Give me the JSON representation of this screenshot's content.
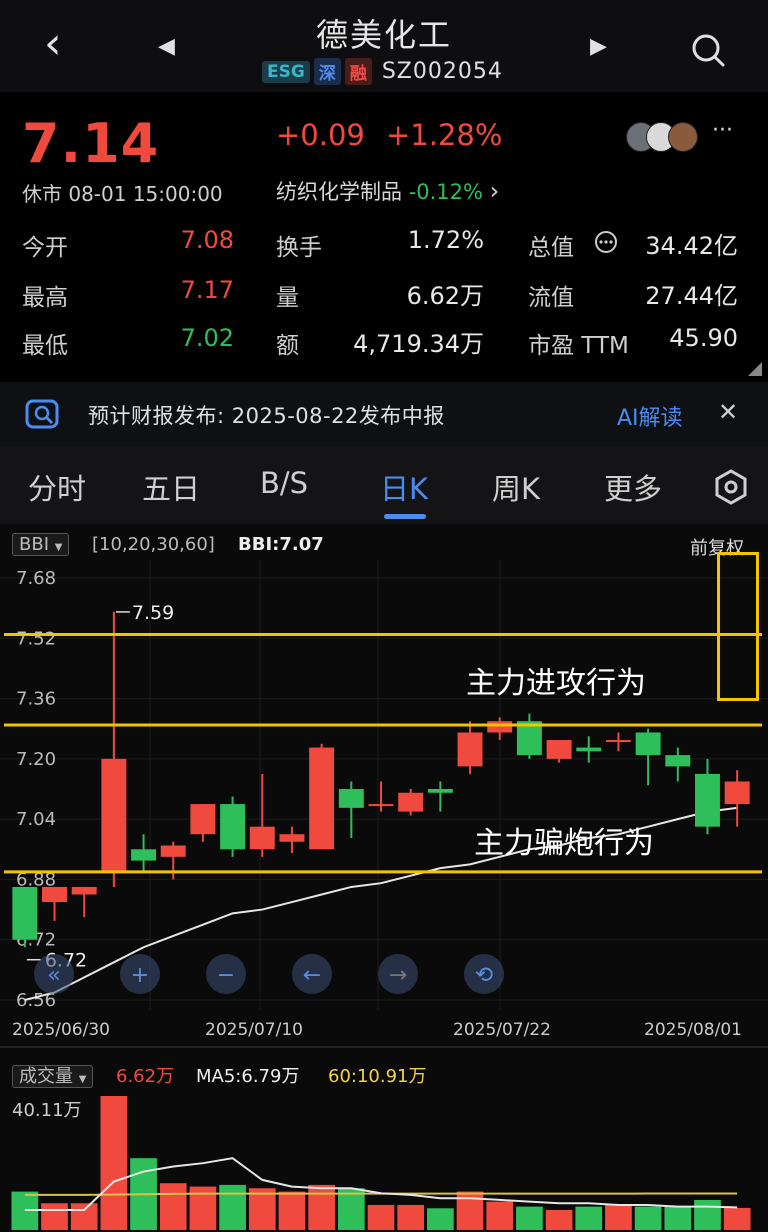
{
  "nav": {
    "back_icon": "‹",
    "prev_icon": "◀",
    "next_icon": "▶",
    "title": "德美化工",
    "badges": [
      "ESG",
      "深",
      "融"
    ],
    "code": "SZ002054"
  },
  "quote": {
    "price": "7.14",
    "change": "+0.09",
    "change_pct": "+1.28%",
    "status": "休市 08-01 15:00:00",
    "sector_name": "纺织化学制品",
    "sector_pct": "-0.12%",
    "sector_arrow": "›",
    "more": "···",
    "stats": [
      {
        "label": "今开",
        "value": "7.08",
        "color": "red"
      },
      {
        "label": "换手",
        "value": "1.72%",
        "color": "white"
      },
      {
        "label": "总值",
        "value": "34.42亿",
        "color": "white"
      },
      {
        "label": "最高",
        "value": "7.17",
        "color": "red"
      },
      {
        "label": "量",
        "value": "6.62万",
        "color": "white"
      },
      {
        "label": "流值",
        "value": "27.44亿",
        "color": "white"
      },
      {
        "label": "最低",
        "value": "7.02",
        "color": "green"
      },
      {
        "label": "额",
        "value": "4,719.34万",
        "color": "white"
      },
      {
        "label": "市盈 TTM",
        "value": "45.90",
        "color": "white"
      }
    ]
  },
  "banner": {
    "text": "预计财报发布: 2025-08-22发布中报",
    "ai_label": "AI解读",
    "close_icon": "✕"
  },
  "tabs": [
    "分时",
    "五日",
    "B/S",
    "日K",
    "周K",
    "更多"
  ],
  "active_tab": "日K",
  "indicator": {
    "name": "BBI",
    "params": "[10,20,30,60]",
    "value": "BBI:7.07",
    "adjust": "前复权"
  },
  "volume_bar": {
    "name": "成交量",
    "today": "6.62万",
    "ma5": "MA5:6.79万",
    "ma60": "60:10.91万"
  },
  "annotations": [
    "主力进攻行为",
    "主力骗炮行为"
  ],
  "colors": {
    "up": "#f04a3e",
    "down": "#2fbf5a",
    "accent": "#4a8cf0",
    "annotation": "#f2c500"
  },
  "chart_data": [
    {
      "type": "candlestick",
      "title": "日K",
      "x": [
        "2025/06/30",
        "2025/07/01",
        "2025/07/02",
        "2025/07/03",
        "2025/07/04",
        "2025/07/07",
        "2025/07/08",
        "2025/07/09",
        "2025/07/10",
        "2025/07/11",
        "2025/07/14",
        "2025/07/15",
        "2025/07/16",
        "2025/07/17",
        "2025/07/18",
        "2025/07/21",
        "2025/07/22",
        "2025/07/23",
        "2025/07/24",
        "2025/07/25",
        "2025/07/28",
        "2025/07/29",
        "2025/07/30",
        "2025/07/31",
        "2025/08/01"
      ],
      "x_tick_labels": [
        "2025/06/30",
        "2025/07/10",
        "2025/07/22",
        "2025/08/01"
      ],
      "ohlc": [
        [
          6.86,
          6.86,
          6.7,
          6.72
        ],
        [
          6.82,
          6.86,
          6.77,
          6.86
        ],
        [
          6.84,
          6.86,
          6.78,
          6.86
        ],
        [
          6.9,
          7.59,
          6.86,
          7.2
        ],
        [
          6.96,
          7.0,
          6.9,
          6.93
        ],
        [
          6.94,
          6.98,
          6.88,
          6.97
        ],
        [
          7.0,
          7.08,
          6.98,
          7.08
        ],
        [
          7.08,
          7.1,
          6.94,
          6.96
        ],
        [
          6.96,
          7.16,
          6.94,
          7.02
        ],
        [
          6.98,
          7.02,
          6.95,
          7.0
        ],
        [
          6.96,
          7.24,
          6.96,
          7.23
        ],
        [
          7.12,
          7.14,
          6.99,
          7.07
        ],
        [
          7.08,
          7.14,
          7.06,
          7.08
        ],
        [
          7.06,
          7.12,
          7.05,
          7.11
        ],
        [
          7.12,
          7.14,
          7.06,
          7.11
        ],
        [
          7.18,
          7.3,
          7.16,
          7.27
        ],
        [
          7.27,
          7.31,
          7.25,
          7.3
        ],
        [
          7.3,
          7.32,
          7.2,
          7.21
        ],
        [
          7.2,
          7.24,
          7.19,
          7.25
        ],
        [
          7.23,
          7.26,
          7.19,
          7.22
        ],
        [
          7.25,
          7.27,
          7.22,
          7.25
        ],
        [
          7.27,
          7.28,
          7.13,
          7.21
        ],
        [
          7.21,
          7.23,
          7.14,
          7.18
        ],
        [
          7.16,
          7.2,
          7.0,
          7.02
        ],
        [
          7.08,
          7.17,
          7.02,
          7.14
        ]
      ],
      "bbi": [
        6.56,
        6.58,
        6.62,
        6.66,
        6.7,
        6.73,
        6.76,
        6.79,
        6.8,
        6.82,
        6.84,
        6.86,
        6.87,
        6.89,
        6.91,
        6.92,
        6.94,
        6.96,
        6.97,
        6.99,
        7.0,
        7.02,
        7.04,
        7.06,
        7.07
      ],
      "y_ticks": [
        7.68,
        7.52,
        7.36,
        7.2,
        7.04,
        6.88,
        6.72,
        6.56
      ],
      "ylim": [
        6.56,
        7.68
      ],
      "high_label": "7.59",
      "low_label": "6.72",
      "horizontal_lines": [
        7.53,
        7.29,
        6.9
      ]
    },
    {
      "type": "bar",
      "title": "成交量",
      "x": [
        "2025/06/30",
        "2025/07/01",
        "2025/07/02",
        "2025/07/03",
        "2025/07/04",
        "2025/07/07",
        "2025/07/08",
        "2025/07/09",
        "2025/07/10",
        "2025/07/11",
        "2025/07/14",
        "2025/07/15",
        "2025/07/16",
        "2025/07/17",
        "2025/07/18",
        "2025/07/21",
        "2025/07/22",
        "2025/07/23",
        "2025/07/24",
        "2025/07/25",
        "2025/07/28",
        "2025/07/29",
        "2025/07/30",
        "2025/07/31",
        "2025/08/01"
      ],
      "values": [
        11.5,
        8.0,
        8.0,
        40.11,
        21.5,
        14.0,
        13.0,
        13.5,
        12.5,
        11.5,
        13.5,
        12.5,
        7.5,
        7.5,
        6.5,
        11.5,
        8.5,
        7.0,
        6.0,
        7.0,
        7.5,
        7.0,
        7.0,
        9.0,
        6.62
      ],
      "ma5": [
        6.0,
        6.0,
        6.0,
        14.5,
        17.5,
        19.0,
        20.0,
        21.5,
        15.0,
        13.0,
        12.5,
        12.5,
        11.0,
        10.5,
        9.5,
        9.5,
        9.0,
        8.5,
        8.0,
        8.0,
        7.5,
        7.5,
        7.0,
        7.0,
        6.79
      ],
      "ma60": [
        10.5,
        10.5,
        10.5,
        10.6,
        10.7,
        10.8,
        10.9,
        10.9,
        10.9,
        10.9,
        10.9,
        10.9,
        10.9,
        10.9,
        10.9,
        10.9,
        10.9,
        10.9,
        10.9,
        10.9,
        10.9,
        10.91,
        10.91,
        10.91,
        10.91
      ],
      "y_max_label": "40.11万",
      "ylim": [
        0,
        40.11
      ]
    }
  ]
}
